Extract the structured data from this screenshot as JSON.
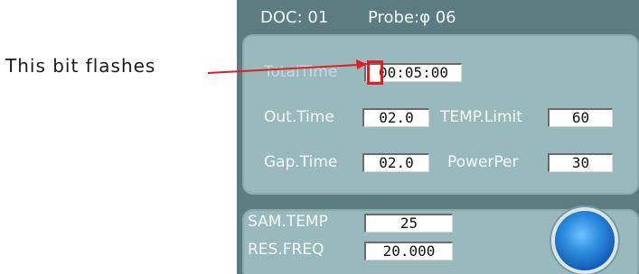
{
  "annotation": {
    "text": "This bit flashes"
  },
  "header": {
    "doc": "DOC:  01",
    "probe": "Probe:φ 06"
  },
  "settings": {
    "total_time_label": "TotalTime",
    "total_time_value": "00:05:00",
    "out_time_label": "Out.Time",
    "out_time_value": "02.0",
    "temp_limit_label": "TEMP.Limit",
    "temp_limit_value": "60",
    "gap_time_label": "Gap.Time",
    "gap_time_value": "02.0",
    "power_per_label": "PowerPer",
    "power_per_value": "30"
  },
  "status": {
    "sam_temp_label": "SAM.TEMP",
    "sam_temp_value": "25",
    "res_freq_label": "RES.FREQ",
    "res_freq_value": "20.000"
  },
  "colors": {
    "device_bg": "#5d7c82",
    "panel_bg": "#9ab9bc",
    "highlight": "#e21d24",
    "knob": "#2f8fe0"
  },
  "icons": {
    "knob": "start-knob-icon"
  }
}
